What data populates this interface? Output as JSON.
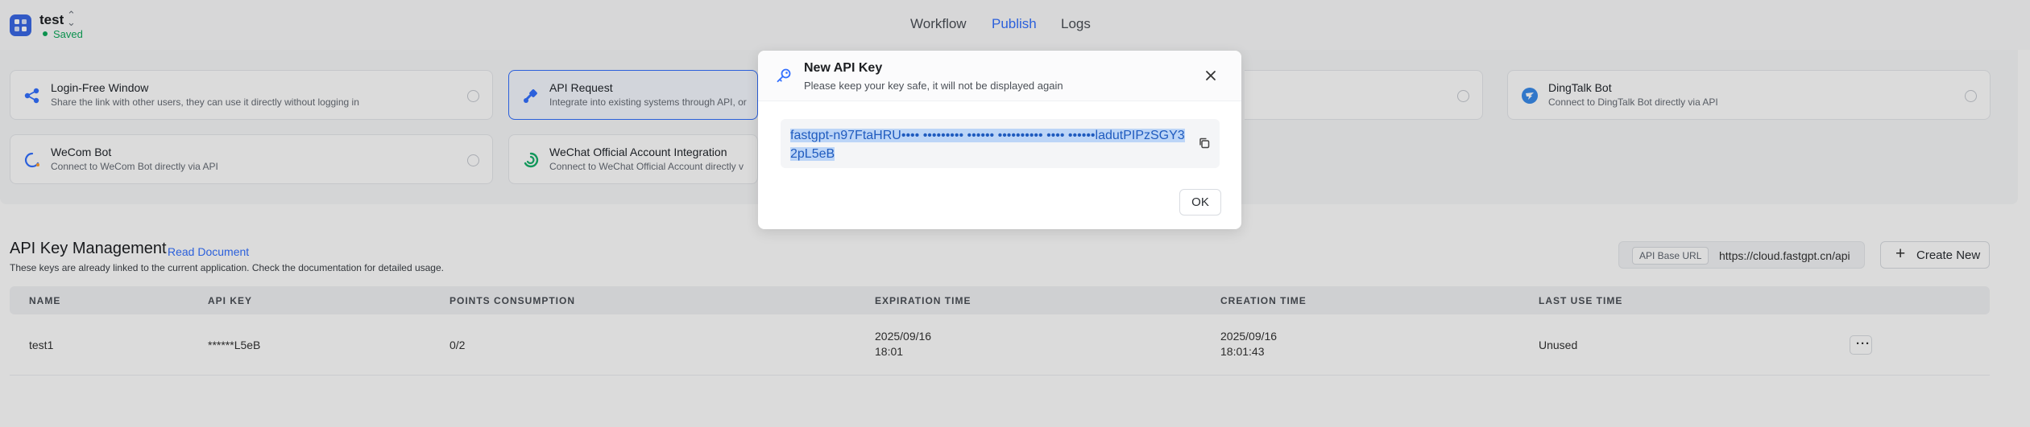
{
  "app": {
    "name": "test",
    "status": "Saved"
  },
  "nav": {
    "workflow": "Workflow",
    "publish": "Publish",
    "logs": "Logs"
  },
  "cards": [
    {
      "title": "Login-Free Window",
      "desc": "Share the link with other users, they can use it directly without logging in",
      "icon": "share-nodes-icon"
    },
    {
      "title": "API Request",
      "desc": "Integrate into existing systems through API, or",
      "icon": "api-link-icon"
    },
    {
      "title": "DingTalk Bot",
      "desc": "Connect to DingTalk Bot directly via API",
      "icon": "dingtalk-icon"
    },
    {
      "title": "WeCom Bot",
      "desc": "Connect to WeCom Bot directly via API",
      "icon": "wecom-icon"
    },
    {
      "title": "WeChat Official Account Integration",
      "desc": "Connect to WeChat Official Account directly v",
      "icon": "wechat-official-icon"
    }
  ],
  "api_keys": {
    "title": "API Key Management",
    "read_doc": "Read Document",
    "desc": "These keys are already linked to the current application. Check the documentation for detailed usage.",
    "base_url_label": "API Base URL",
    "base_url": "https://cloud.fastgpt.cn/api",
    "create_label": "Create New",
    "columns": [
      "NAME",
      "API KEY",
      "POINTS CONSUMPTION",
      "EXPIRATION TIME",
      "CREATION TIME",
      "LAST USE TIME"
    ],
    "rows": [
      {
        "name": "test1",
        "key": "******L5eB",
        "points": "0/2",
        "exp_date": "2025/09/16",
        "exp_time": "18:01",
        "created_date": "2025/09/16",
        "created_time": "18:01:43",
        "last_use": "Unused"
      }
    ]
  },
  "modal": {
    "title": "New API Key",
    "subtitle": "Please keep your key safe, it will not be displayed again",
    "key": "fastgpt-n97FtaHRU•••• ••••••••• •••••• •••••••••• •••• ••••••ladutPIPzSGY32pL5eB",
    "ok": "OK"
  },
  "colors": {
    "accent": "#3370ff",
    "saved": "#0ea95b",
    "highlight": "#bcd5f7"
  }
}
